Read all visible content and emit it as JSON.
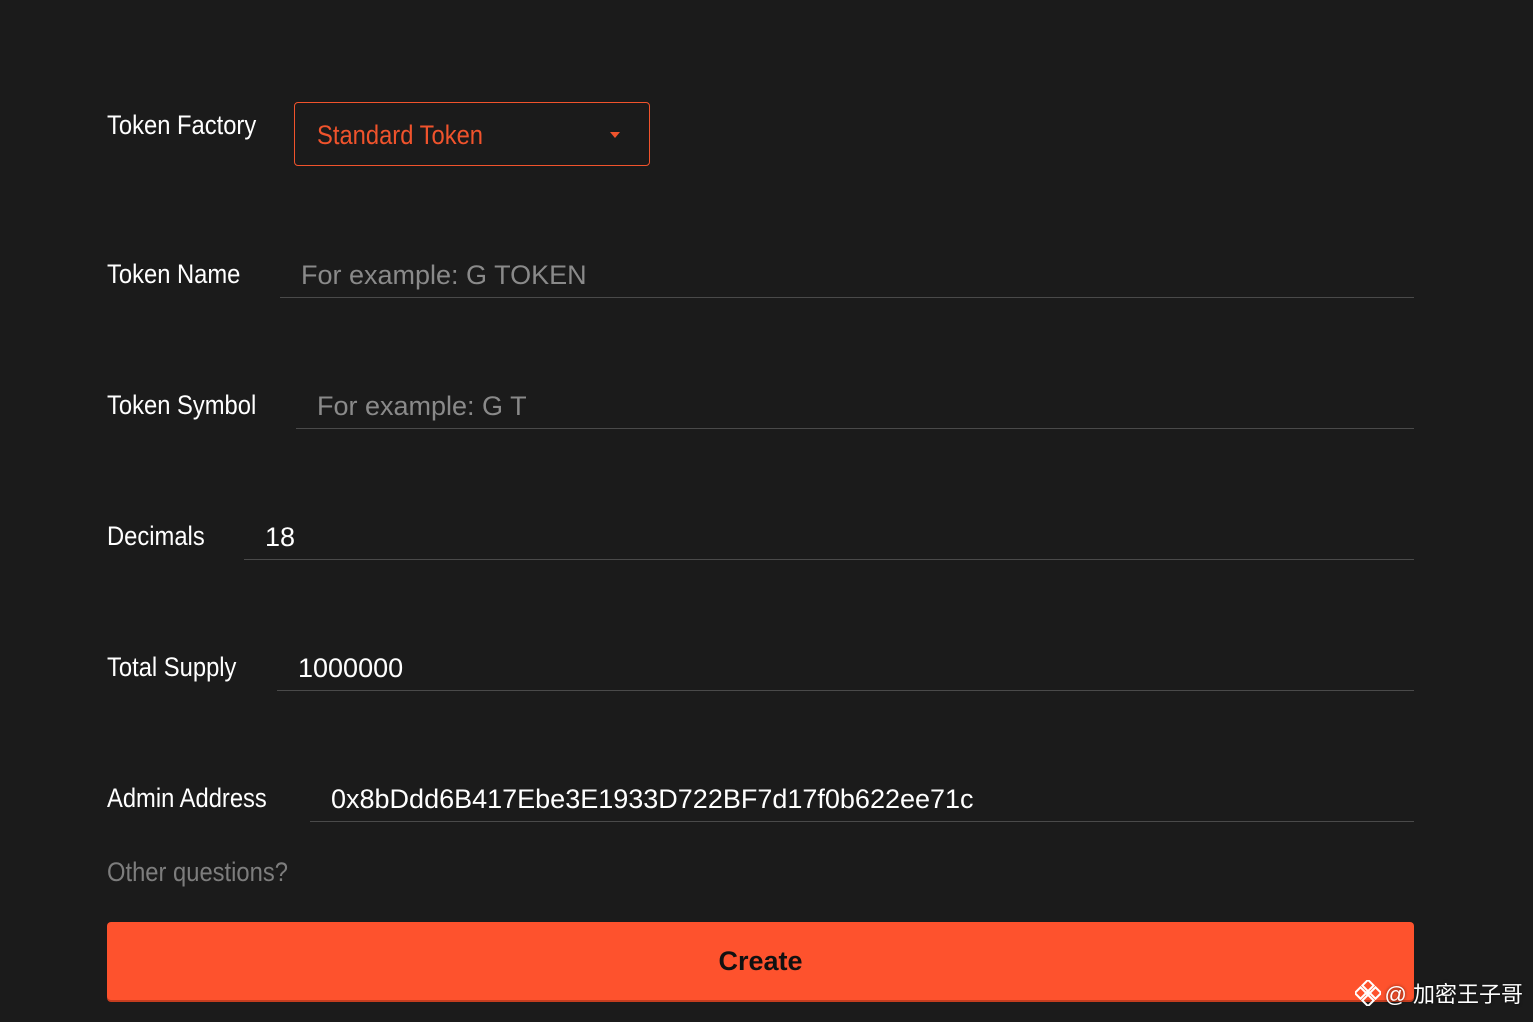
{
  "form": {
    "token_factory": {
      "label": "Token Factory",
      "selected": "Standard Token"
    },
    "token_name": {
      "label": "Token Name",
      "placeholder": "For example: G TOKEN",
      "value": ""
    },
    "token_symbol": {
      "label": "Token Symbol",
      "placeholder": "For example: G T",
      "value": ""
    },
    "decimals": {
      "label": "Decimals",
      "value": "18"
    },
    "total_supply": {
      "label": "Total Supply",
      "value": "1000000"
    },
    "admin_address": {
      "label": "Admin Address",
      "value": "0x8bDdd6B417Ebe3E1933D722BF7d17f0b622ee71c"
    },
    "help_link": "Other questions?",
    "create_label": "Create"
  },
  "watermark": {
    "icon": "binance-logo-icon",
    "text": "@ 加密王子哥"
  },
  "colors": {
    "background": "#1b1b1b",
    "accent": "#fe522d",
    "select_text": "#f0532c",
    "placeholder": "#8a8a8a",
    "divider": "#4a4a4a"
  }
}
